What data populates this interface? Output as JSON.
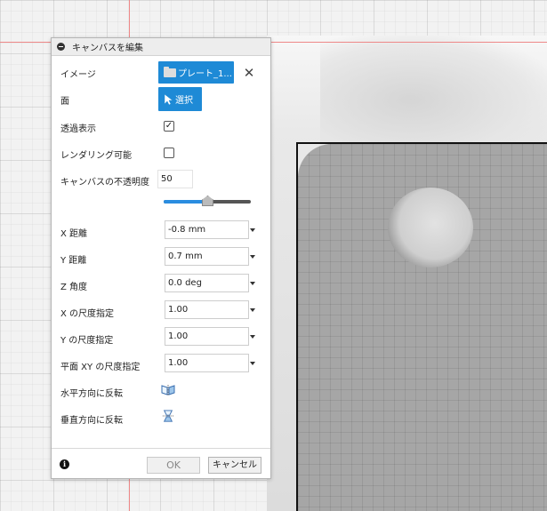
{
  "dialog": {
    "title": "キャンバスを編集",
    "image_label": "イメージ",
    "image_file": "プレート_1...",
    "face_label": "面",
    "face_button": "選択",
    "transparent_label": "透過表示",
    "transparent_checked": true,
    "render_label": "レンダリング可能",
    "render_checked": false,
    "opacity_label": "キャンバスの不透明度",
    "opacity_value": "50",
    "opacity_percent": 50,
    "x_distance_label": "X 距離",
    "x_distance_value": "-0.8 mm",
    "y_distance_label": "Y 距離",
    "y_distance_value": "0.7 mm",
    "z_angle_label": "Z 角度",
    "z_angle_value": "0.0 deg",
    "x_scale_label": "X の尺度指定",
    "x_scale_value": "1.00",
    "y_scale_label": "Y の尺度指定",
    "y_scale_value": "1.00",
    "xy_scale_label": "平面 XY の尺度指定",
    "xy_scale_value": "1.00",
    "flip_h_label": "水平方向に反転",
    "flip_v_label": "垂直方向に反転",
    "ok_label": "OK",
    "cancel_label": "キャンセル",
    "accent_color": "#1e8ad6"
  }
}
